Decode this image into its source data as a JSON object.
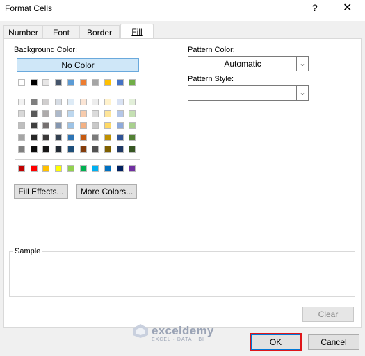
{
  "window": {
    "title": "Format Cells",
    "help_label": "?",
    "close_label": "✕"
  },
  "tabs": [
    {
      "label": "Number"
    },
    {
      "label": "Font"
    },
    {
      "label": "Border"
    },
    {
      "label": "Fill",
      "active": true
    }
  ],
  "fill": {
    "background_color_label": "Background Color:",
    "no_color_label": "No Color",
    "theme_row": [
      "#ffffff",
      "#000000",
      "#e7e6e6",
      "#44546a",
      "#5b9bd5",
      "#ed7d31",
      "#a5a5a5",
      "#ffc000",
      "#4472c4",
      "#70ad47"
    ],
    "tint_rows": [
      [
        "#f2f2f2",
        "#7f7f7f",
        "#d0cece",
        "#d6dce4",
        "#deebf6",
        "#fbe5d5",
        "#ededed",
        "#fff2cc",
        "#d9e2f3",
        "#e2efd9"
      ],
      [
        "#d8d8d8",
        "#595959",
        "#aeabab",
        "#adb9ca",
        "#bdd7ee",
        "#f7cbac",
        "#dbdbdb",
        "#fee599",
        "#b4c6e7",
        "#c5e0b3"
      ],
      [
        "#bfbfbf",
        "#3f3f3f",
        "#757070",
        "#8496b0",
        "#9dc3e6",
        "#f4b183",
        "#c9c9c9",
        "#ffd965",
        "#8eaadb",
        "#a8d08d"
      ],
      [
        "#a5a5a5",
        "#262626",
        "#3a3838",
        "#323f4f",
        "#2e75b5",
        "#c55a11",
        "#7b7b7b",
        "#bf9000",
        "#2f5496",
        "#538135"
      ],
      [
        "#7f7f7f",
        "#0c0c0c",
        "#171616",
        "#222a35",
        "#1e4e79",
        "#833c0b",
        "#525252",
        "#7f6000",
        "#1f3864",
        "#375623"
      ]
    ],
    "standard_row": [
      "#c00000",
      "#ff0000",
      "#ffc000",
      "#ffff00",
      "#92d050",
      "#00b050",
      "#00b0f0",
      "#0070c0",
      "#002060",
      "#7030a0"
    ],
    "fill_effects_label": "Fill Effects...",
    "more_colors_label": "More Colors...",
    "pattern_color_label": "Pattern Color:",
    "pattern_color_value": "Automatic",
    "pattern_style_label": "Pattern Style:",
    "pattern_style_value": "",
    "sample_label": "Sample"
  },
  "buttons": {
    "clear": "Clear",
    "ok": "OK",
    "cancel": "Cancel"
  },
  "watermark": {
    "name": "exceldemy",
    "tagline": "EXCEL · DATA · BI"
  }
}
